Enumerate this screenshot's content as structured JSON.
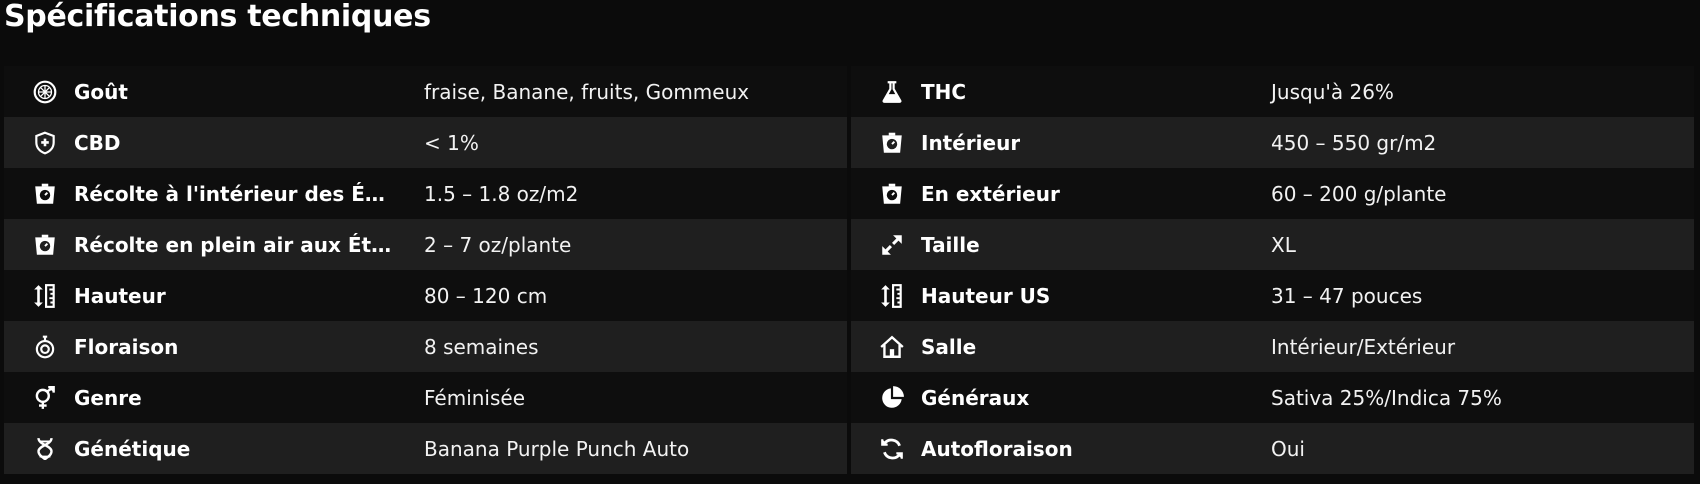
{
  "title": "Spécifications techniques",
  "left": [
    {
      "icon": "lime-slice-icon",
      "label": "Goût",
      "value": "fraise, Banane, fruits, Gommeux"
    },
    {
      "icon": "shield-plus-icon",
      "label": "CBD",
      "value": "< 1%"
    },
    {
      "icon": "weight-scale-icon",
      "label": "Récolte à l'intérieur des États-Unis",
      "value": "1.5 – 1.8 oz/m2"
    },
    {
      "icon": "weight-scale-icon",
      "label": "Récolte en plein air aux États-Unis",
      "value": "2 – 7 oz/plante"
    },
    {
      "icon": "height-ruler-icon",
      "label": "Hauteur",
      "value": "80 – 120 cm"
    },
    {
      "icon": "stopwatch-icon",
      "label": "Floraison",
      "value": "8 semaines"
    },
    {
      "icon": "gender-icon",
      "label": "Genre",
      "value": "Féminisée"
    },
    {
      "icon": "dna-icon",
      "label": "Génétique",
      "value": "Banana Purple Punch Auto"
    }
  ],
  "right": [
    {
      "icon": "flask-icon",
      "label": "THC",
      "value": "Jusqu'à 26%"
    },
    {
      "icon": "weight-scale-icon",
      "label": "Intérieur",
      "value": "450 – 550 gr/m2"
    },
    {
      "icon": "weight-scale-icon",
      "label": "En extérieur",
      "value": "60 – 200 g/plante"
    },
    {
      "icon": "expand-arrows-icon",
      "label": "Taille",
      "value": "XL"
    },
    {
      "icon": "height-ruler-icon",
      "label": "Hauteur US",
      "value": "31 – 47 pouces"
    },
    {
      "icon": "house-icon",
      "label": "Salle",
      "value": "Intérieur/Extérieur"
    },
    {
      "icon": "pie-chart-icon",
      "label": "Généraux",
      "value": "Sativa 25%/Indica 75%"
    },
    {
      "icon": "sync-icon",
      "label": "Autofloraison",
      "value": "Oui"
    }
  ]
}
